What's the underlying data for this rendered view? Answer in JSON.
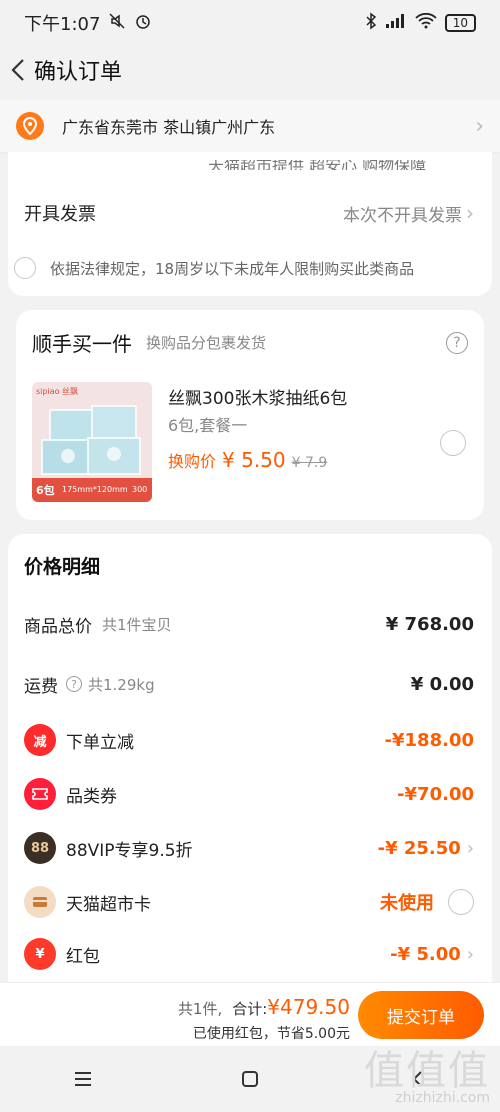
{
  "status": {
    "time": "下午1:07",
    "battery": "10"
  },
  "nav": {
    "title": "确认订单"
  },
  "address": {
    "text": "广东省东莞市 茶山镇广州广东"
  },
  "card1": {
    "faded_text": "天猫超市提供 超安心 购物保障",
    "invoice_label": "开具发票",
    "invoice_value": "本次不开具发票",
    "legal_text": "依据法律规定，18周岁以下未成年人限制购买此类商品"
  },
  "addon": {
    "title": "顺手买一件",
    "subtitle": "换购品分包裹发货",
    "product_name": "丝飘300张木浆抽纸6包",
    "product_spec": "6包,套餐一",
    "swap_label": "换购价",
    "price": "¥ 5.50",
    "old_price": "¥ 7.9",
    "img_brand": "sipiao 丝飘",
    "img_count": "6包",
    "img_size": "175mm*120mm",
    "img_sheets": "300"
  },
  "price_detail": {
    "title": "价格明细",
    "rows": [
      {
        "label": "商品总价",
        "sub": "共1件宝贝",
        "value": "¥ 768.00"
      },
      {
        "label": "运费",
        "sub": "共1.29kg",
        "value": "¥ 0.00"
      },
      {
        "label": "下单立减",
        "value": "-¥188.00",
        "icon": "discount-icon",
        "icon_text": "减"
      },
      {
        "label": "品类券",
        "value": "-¥70.00",
        "icon": "coupon-icon"
      },
      {
        "label": "88VIP专享9.5折",
        "value": "-¥ 25.50",
        "icon": "vip-88-icon",
        "icon_text": "88"
      },
      {
        "label": "天猫超市卡",
        "value": "未使用",
        "icon": "card-icon"
      },
      {
        "label": "红包",
        "value": "-¥ 5.00",
        "icon": "red-packet-icon",
        "icon_text": "¥"
      }
    ]
  },
  "footer": {
    "count": "共1件,",
    "total_label": "合计:",
    "total": "¥479.50",
    "saved": "已使用红包，节省5.00元",
    "submit": "提交订单"
  },
  "watermark": {
    "logo": "值值值",
    "url": "zhizhizhi.com"
  },
  "colors": {
    "accent": "#ff5b00",
    "submit_gradient_start": "#ff8a00"
  }
}
